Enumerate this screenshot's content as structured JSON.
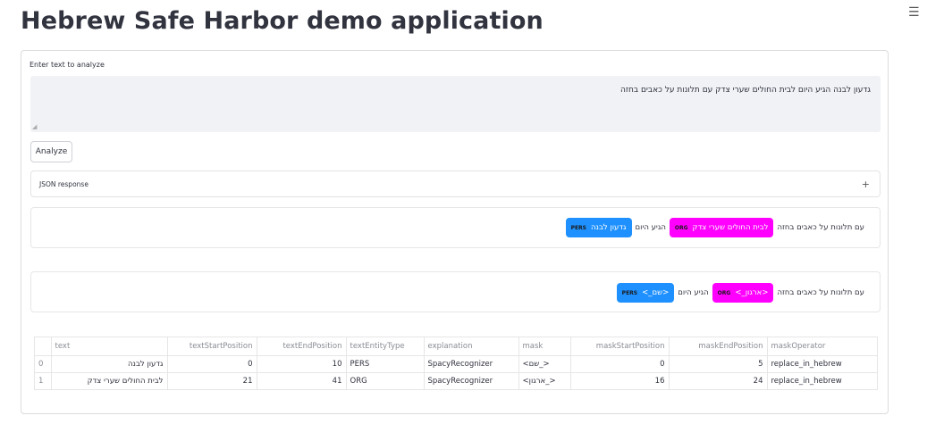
{
  "app": {
    "title": "Hebrew Safe Harbor demo application",
    "menu_icon": "hamburger-menu-icon"
  },
  "input": {
    "label": "Enter text to analyze",
    "value": "גדעון לבנה הגיע היום לבית החולים שערי צדק עם תלונות על כאבים בחזה"
  },
  "analyze_button": {
    "label": "Analyze"
  },
  "json_expander": {
    "label": "JSON response",
    "toggle": "+"
  },
  "annotated": {
    "segments": [
      {
        "text": "גדעון לבנה",
        "entity": "PERS"
      },
      {
        "text": "הגיע היום",
        "entity": null
      },
      {
        "text": "לבית החולים שערי צדק",
        "entity": "ORG"
      },
      {
        "text": "עם תלונות על כאבים בחזה",
        "entity": null
      }
    ]
  },
  "masked": {
    "segments": [
      {
        "text": "<שם_>",
        "entity": "PERS"
      },
      {
        "text": "הגיע היום",
        "entity": null
      },
      {
        "text": "<ארגון_>",
        "entity": "ORG"
      },
      {
        "text": "עם תלונות על כאבים בחזה",
        "entity": null
      }
    ]
  },
  "entity_colors": {
    "PERS": "#1e90ff",
    "ORG": "#ff00ff"
  },
  "table": {
    "columns": [
      "",
      "text",
      "textStartPosition",
      "textEndPosition",
      "textEntityType",
      "explanation",
      "mask",
      "maskStartPosition",
      "maskEndPosition",
      "maskOperator"
    ],
    "rows": [
      [
        "0",
        "גדעון לבנה",
        "0",
        "10",
        "PERS",
        "SpacyRecognizer",
        "<שם_>",
        "0",
        "5",
        "replace_in_hebrew"
      ],
      [
        "1",
        "לבית החולים שערי צדק",
        "21",
        "41",
        "ORG",
        "SpacyRecognizer",
        "<ארגון_>",
        "16",
        "24",
        "replace_in_hebrew"
      ]
    ]
  }
}
